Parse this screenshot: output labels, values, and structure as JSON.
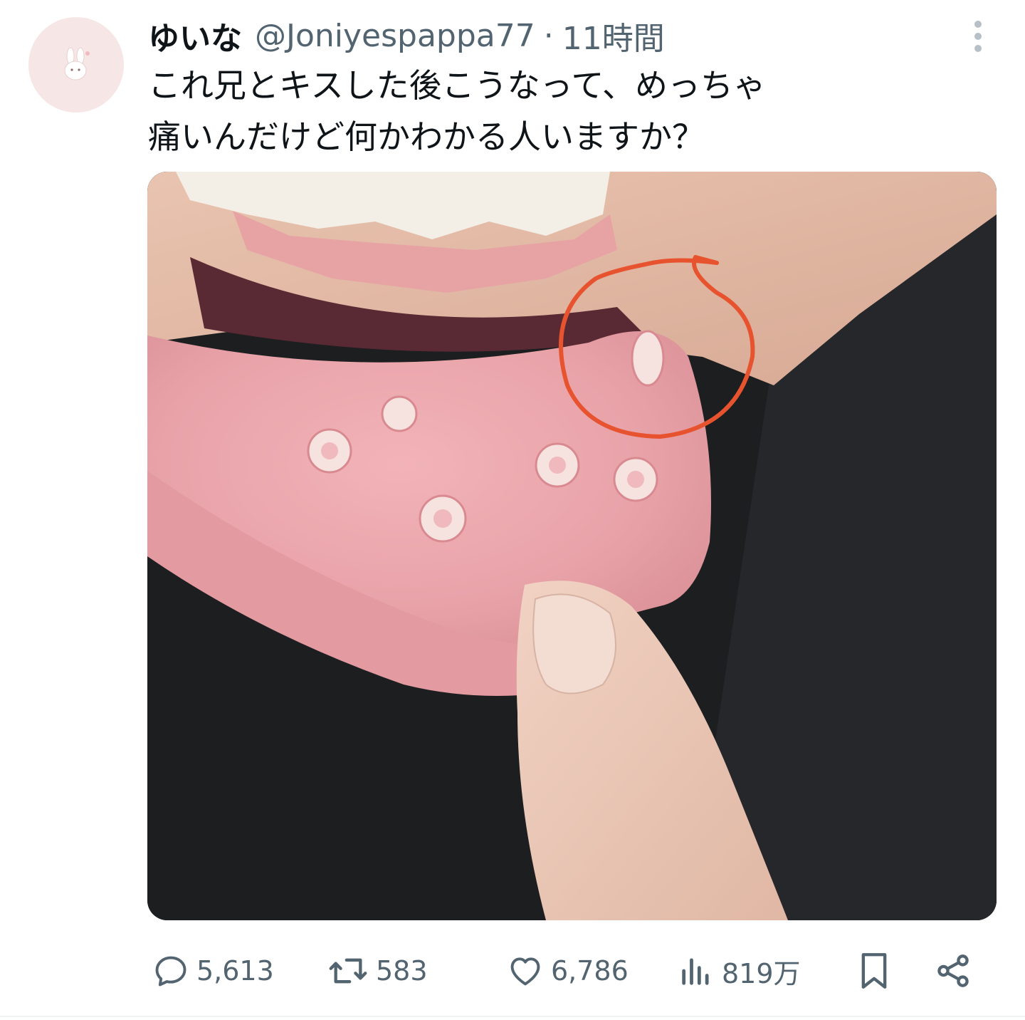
{
  "tweet": {
    "author": {
      "display_name": "ゆいな",
      "handle": "@Joniyespappa77",
      "avatar_icon": "bunny-icon"
    },
    "separator": "·",
    "time": "11時間",
    "text_lines": [
      "これ兄とキスした後こうなって、めっちゃ",
      "痛いんだけど何かわかる人いますか？"
    ],
    "media": {
      "icon": "photo-lip-sores"
    }
  },
  "actions": {
    "reply": {
      "icon": "reply-icon",
      "count": "5,613"
    },
    "retweet": {
      "icon": "retweet-icon",
      "count": "583"
    },
    "like": {
      "icon": "heart-icon",
      "count": "6,786"
    },
    "views": {
      "icon": "views-icon",
      "count": "819万"
    },
    "bookmark": {
      "icon": "bookmark-icon"
    },
    "share": {
      "icon": "share-icon"
    }
  },
  "colors": {
    "text_primary": "#0f1419",
    "text_secondary": "#536471",
    "divider": "#eff3f4",
    "annotation_circle": "#e8532f"
  }
}
